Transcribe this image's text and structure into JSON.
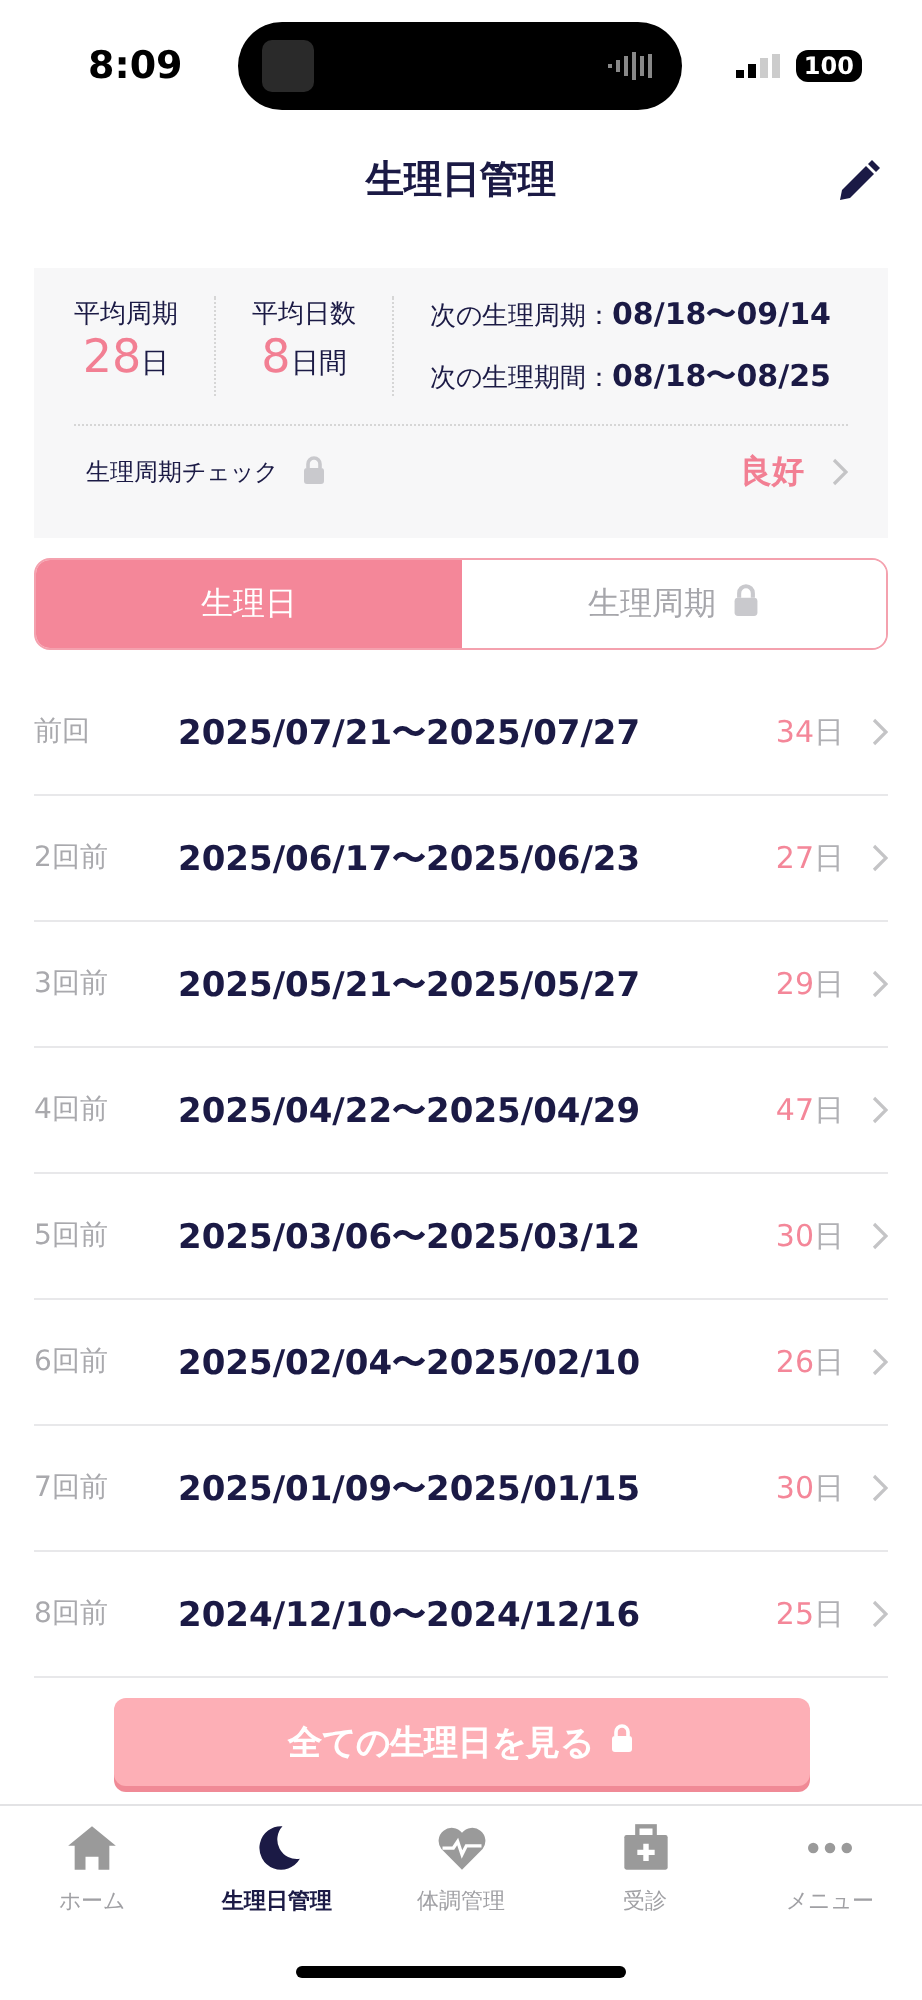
{
  "status_bar": {
    "time": "8:09",
    "battery": "100"
  },
  "header": {
    "title": "生理日管理"
  },
  "summary": {
    "stats": [
      {
        "label": "平均周期",
        "value": "28",
        "unit": "日"
      },
      {
        "label": "平均日数",
        "value": "8",
        "unit": "日間"
      }
    ],
    "next": [
      {
        "label": "次の生理周期：",
        "value": "08/18〜09/14"
      },
      {
        "label": "次の生理期間：",
        "value": "08/18〜08/25"
      }
    ],
    "check": {
      "label": "生理周期チェック",
      "locked": true,
      "status": "良好"
    }
  },
  "tabs": [
    {
      "label": "生理日",
      "selected": true,
      "locked": false
    },
    {
      "label": "生理周期",
      "selected": false,
      "locked": true
    }
  ],
  "periods": [
    {
      "label": "前回",
      "dates": "2025/07/21〜2025/07/27",
      "days": "34",
      "unit": "日"
    },
    {
      "label": "2回前",
      "dates": "2025/06/17〜2025/06/23",
      "days": "27",
      "unit": "日"
    },
    {
      "label": "3回前",
      "dates": "2025/05/21〜2025/05/27",
      "days": "29",
      "unit": "日"
    },
    {
      "label": "4回前",
      "dates": "2025/04/22〜2025/04/29",
      "days": "47",
      "unit": "日"
    },
    {
      "label": "5回前",
      "dates": "2025/03/06〜2025/03/12",
      "days": "30",
      "unit": "日"
    },
    {
      "label": "6回前",
      "dates": "2025/02/04〜2025/02/10",
      "days": "26",
      "unit": "日"
    },
    {
      "label": "7回前",
      "dates": "2025/01/09〜2025/01/15",
      "days": "30",
      "unit": "日"
    },
    {
      "label": "8回前",
      "dates": "2024/12/10〜2024/12/16",
      "days": "25",
      "unit": "日"
    }
  ],
  "all_button": {
    "label": "全ての生理日を見る",
    "locked": true
  },
  "nav": [
    {
      "label": "ホーム",
      "selected": false
    },
    {
      "label": "生理日管理",
      "selected": true
    },
    {
      "label": "体調管理",
      "selected": false
    },
    {
      "label": "受診",
      "selected": false
    },
    {
      "label": "メニュー",
      "selected": false
    }
  ]
}
